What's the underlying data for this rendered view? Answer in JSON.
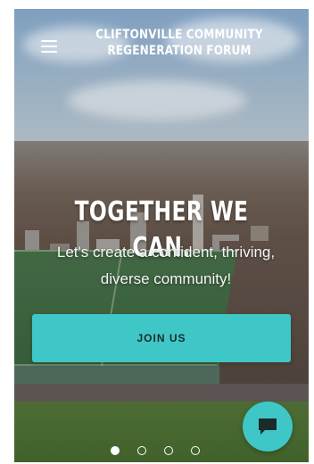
{
  "header": {
    "brand_line1": "CLIFTONVILLE COMMUNITY",
    "brand_line2": "REGENERATION FORUM",
    "menu_icon": "hamburger-menu-icon"
  },
  "hero": {
    "headline": "TOGETHER WE CAN.",
    "subhead": "Let's create a confident, thriving, diverse community!",
    "cta_label": "JOIN US"
  },
  "chat": {
    "icon": "chat-bubble-icon"
  },
  "carousel": {
    "slide_count": 4,
    "active_index": 0
  },
  "colors": {
    "accent": "#3ec7c6",
    "text_light": "#ffffff"
  }
}
